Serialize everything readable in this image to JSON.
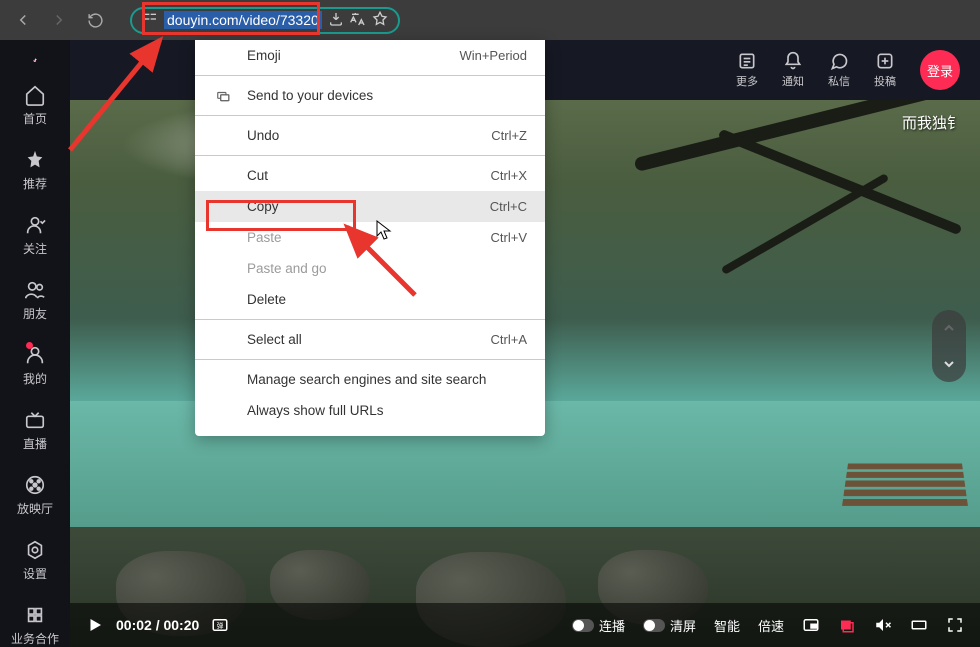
{
  "browser": {
    "url_text": "douyin.com/video/73320"
  },
  "sidebar": {
    "items": [
      {
        "label": "首页"
      },
      {
        "label": "推荐"
      },
      {
        "label": "关注"
      },
      {
        "label": "朋友"
      },
      {
        "label": "我的",
        "dot": true
      },
      {
        "label": "直播"
      },
      {
        "label": "放映厅"
      },
      {
        "label": "设置"
      },
      {
        "label": "业务合作"
      }
    ]
  },
  "topbar": {
    "items": [
      {
        "label": "更多"
      },
      {
        "label": "通知"
      },
      {
        "label": "私信"
      },
      {
        "label": "投稿"
      }
    ],
    "login": "登录"
  },
  "video": {
    "caption": "而我独钅",
    "time": "00:02 / 00:20"
  },
  "controls": {
    "continuous": "连播",
    "clear": "清屏",
    "smart": "智能",
    "speed": "倍速"
  },
  "context_menu": {
    "items": [
      {
        "label": "Emoji",
        "shortcut": "Win+Period",
        "icon": false
      },
      {
        "sep": true
      },
      {
        "label": "Send to your devices",
        "icon": true
      },
      {
        "sep": true
      },
      {
        "label": "Undo",
        "shortcut": "Ctrl+Z",
        "icon": false
      },
      {
        "sep": true
      },
      {
        "label": "Cut",
        "shortcut": "Ctrl+X",
        "icon": false
      },
      {
        "label": "Copy",
        "shortcut": "Ctrl+C",
        "icon": false,
        "hovered": true
      },
      {
        "label": "Paste",
        "shortcut": "Ctrl+V",
        "icon": false,
        "disabled": true
      },
      {
        "label": "Paste and go",
        "icon": false,
        "disabled": true
      },
      {
        "label": "Delete",
        "icon": false
      },
      {
        "sep": true
      },
      {
        "label": "Select all",
        "shortcut": "Ctrl+A",
        "icon": false
      },
      {
        "sep": true
      },
      {
        "label": "Manage search engines and site search",
        "icon": false
      },
      {
        "label": "Always show full URLs",
        "icon": false
      }
    ]
  }
}
